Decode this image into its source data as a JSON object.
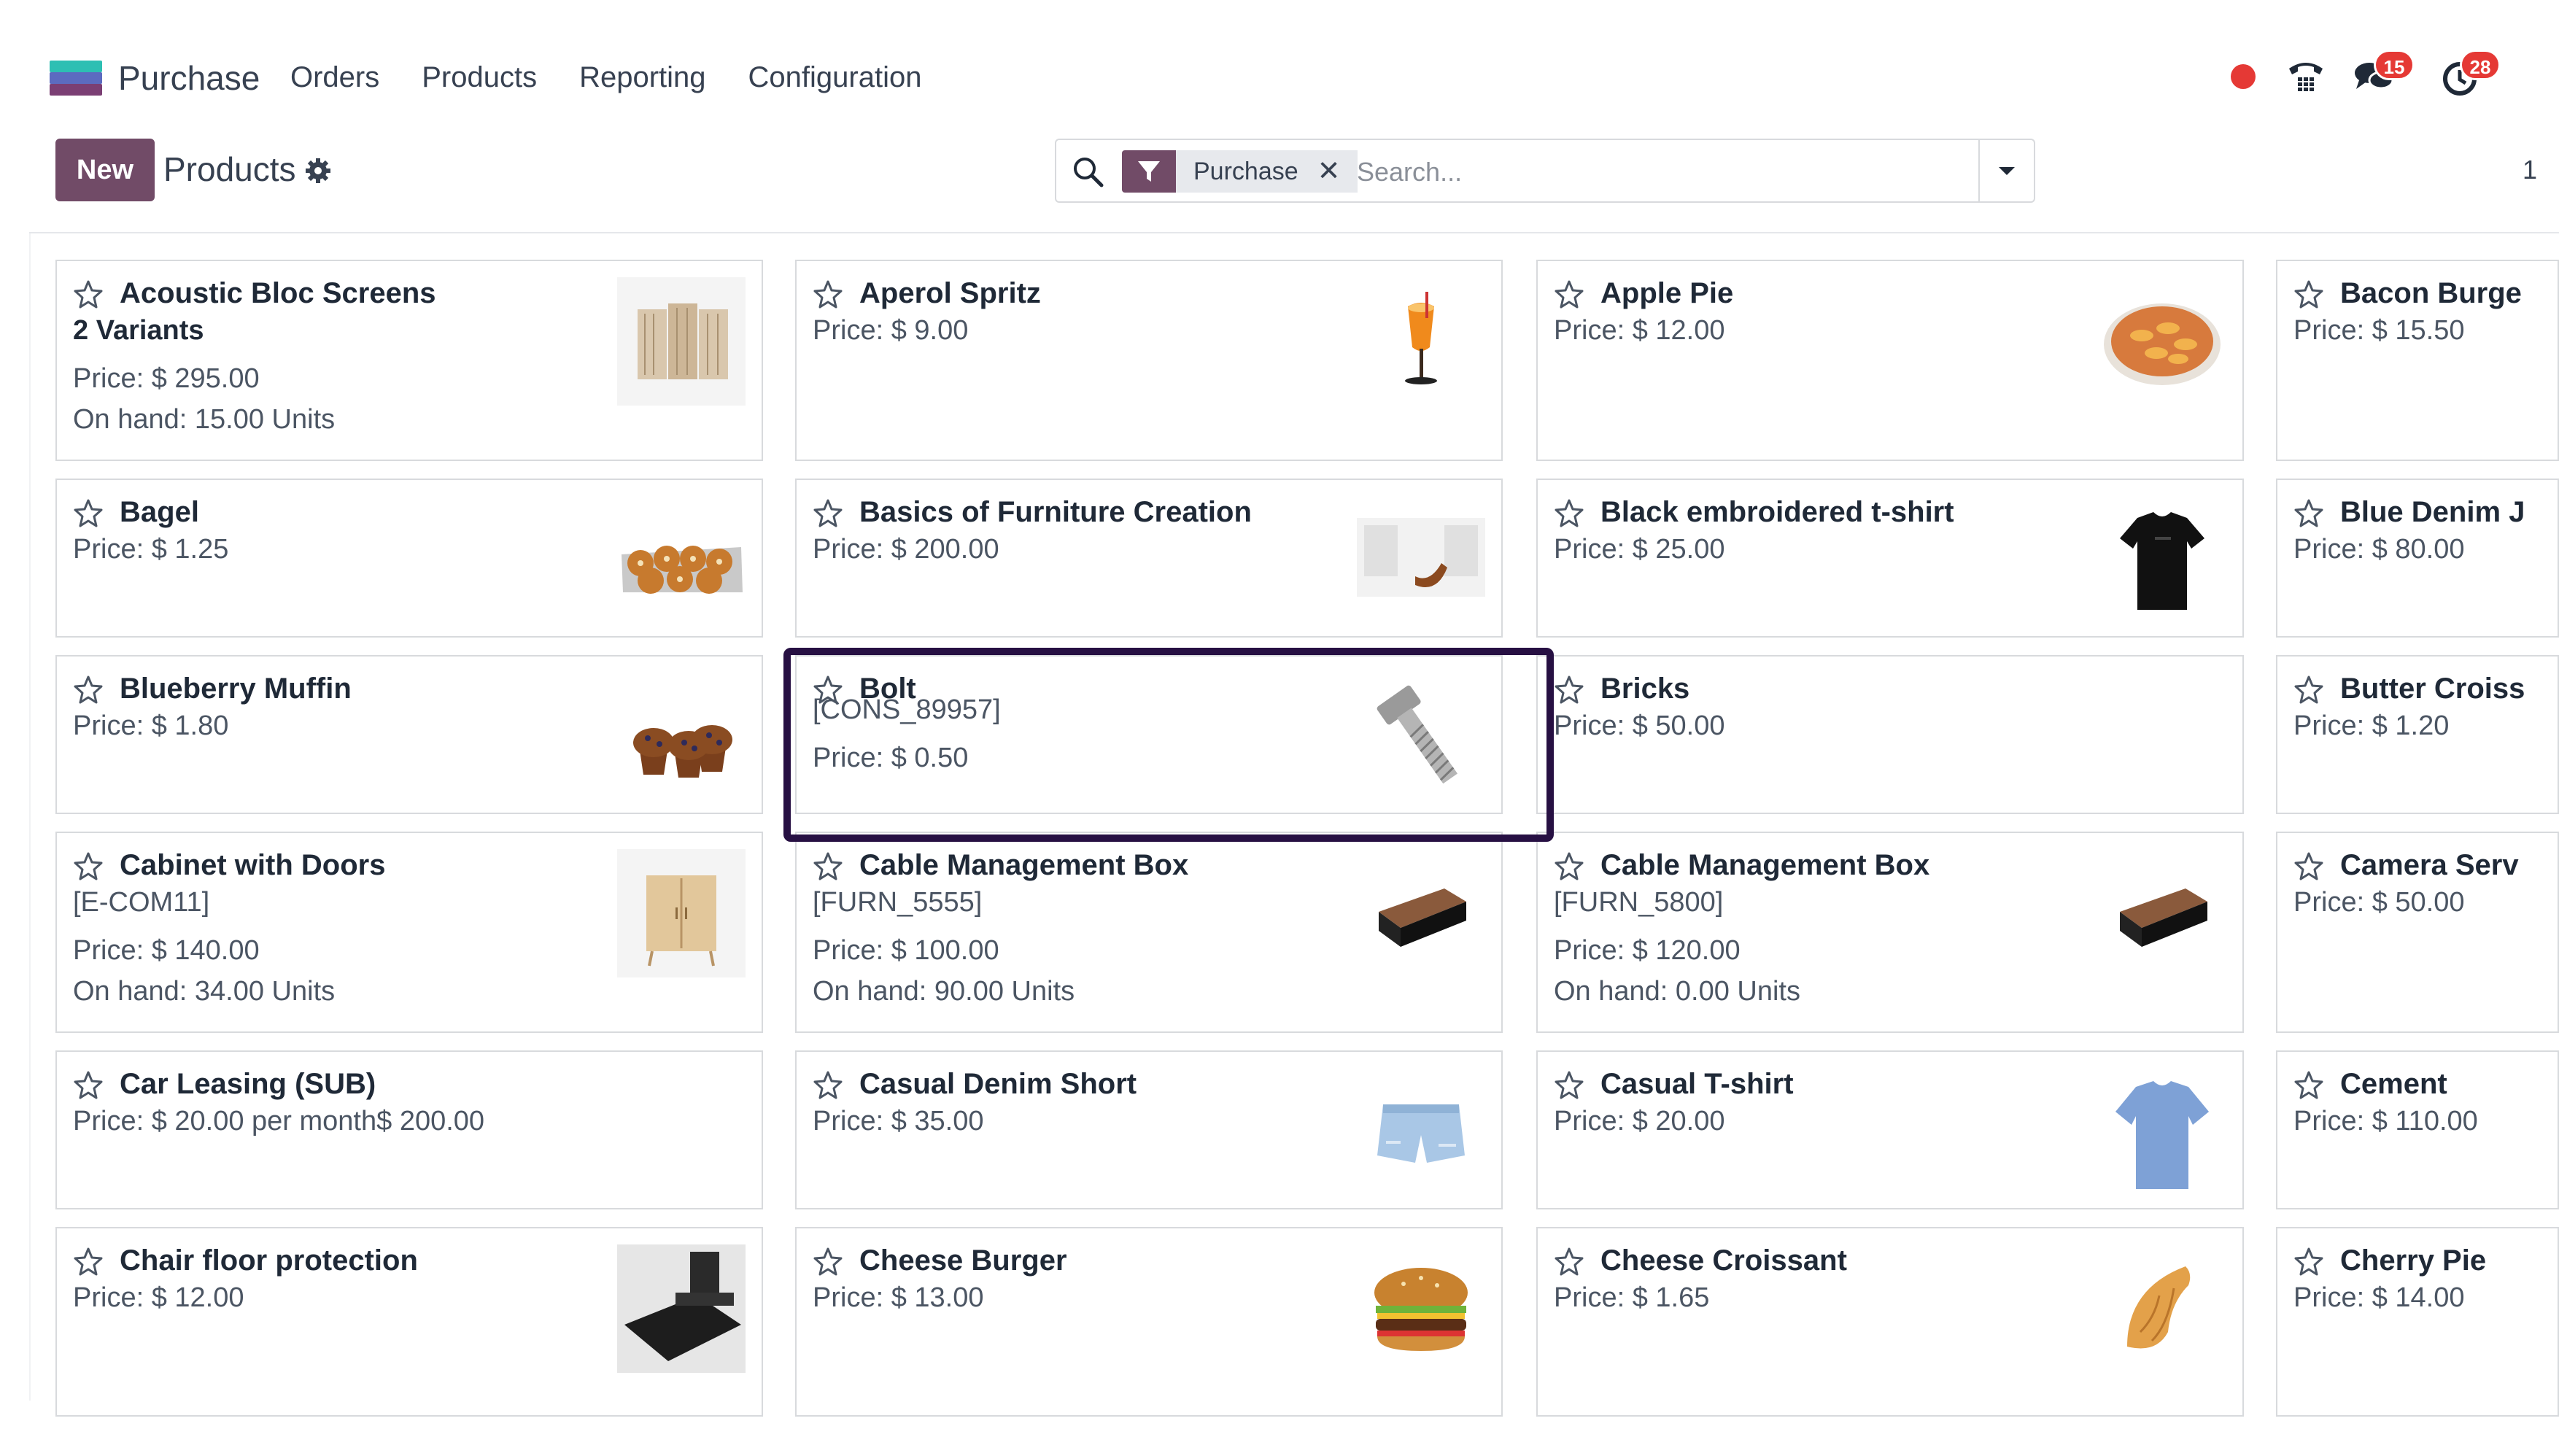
{
  "nav": {
    "app_name": "Purchase",
    "menu": [
      "Orders",
      "Products",
      "Reporting",
      "Configuration"
    ],
    "messages_badge": "15",
    "activities_badge": "28"
  },
  "control": {
    "new_label": "New",
    "title": "Products",
    "facet_label": "Purchase",
    "facet_close": "✕",
    "search_placeholder": "Search...",
    "pager_hint": "1"
  },
  "colors": {
    "brand": "#714b67",
    "selected_outline": "#271043",
    "badge": "#e53935"
  },
  "products": [
    {
      "name": "Acoustic Bloc Screens",
      "lines": [
        "2 Variants",
        "Price: $ 295.00",
        "On hand: 15.00 Units"
      ],
      "variants_bold": true,
      "image": "acoustic-screen-image"
    },
    {
      "name": "Aperol Spritz",
      "lines": [
        "Price: $ 9.00"
      ],
      "image": "cocktail-image"
    },
    {
      "name": "Apple Pie",
      "lines": [
        "Price: $ 12.00"
      ],
      "image": "pie-image"
    },
    {
      "name": "Bacon Burge",
      "lines": [
        "Price: $ 15.50"
      ],
      "image": ""
    },
    {
      "name": "Bagel",
      "lines": [
        "Price: $ 1.25"
      ],
      "image": "bagel-image"
    },
    {
      "name": "Basics of Furniture Creation",
      "lines": [
        "Price: $ 200.00"
      ],
      "image": "course-image"
    },
    {
      "name": "Black embroidered t-shirt",
      "lines": [
        "Price: $ 25.00"
      ],
      "image": "black-tshirt-image"
    },
    {
      "name": "Blue Denim J",
      "lines": [
        "Price: $ 80.00"
      ],
      "image": ""
    },
    {
      "name": "Blueberry Muffin",
      "lines": [
        "Price: $ 1.80"
      ],
      "image": "muffin-image"
    },
    {
      "name": "Bolt",
      "lines": [
        "[CONS_89957]",
        "Price: $ 0.50"
      ],
      "image": "bolt-image",
      "selected": true
    },
    {
      "name": "Bricks",
      "lines": [
        "Price: $ 50.00"
      ],
      "image": ""
    },
    {
      "name": "Butter Croiss",
      "lines": [
        "Price: $ 1.20"
      ],
      "image": ""
    },
    {
      "name": "Cabinet with Doors",
      "lines": [
        "[E-COM11]",
        "Price: $ 140.00",
        "On hand: 34.00 Units"
      ],
      "image": "cabinet-image"
    },
    {
      "name": "Cable Management Box",
      "lines": [
        "[FURN_5555]",
        "Price: $ 100.00",
        "On hand: 90.00 Units"
      ],
      "image": "cable-box-image"
    },
    {
      "name": "Cable Management Box",
      "lines": [
        "[FURN_5800]",
        "Price: $ 120.00",
        "On hand: 0.00 Units"
      ],
      "image": "cable-box-image"
    },
    {
      "name": "Camera Serv",
      "lines": [
        "Price: $ 50.00"
      ],
      "image": ""
    },
    {
      "name": "Car Leasing (SUB)",
      "lines": [
        "Price: $ 20.00 per month$ 200.00"
      ],
      "image": ""
    },
    {
      "name": "Casual Denim Short",
      "lines": [
        "Price: $ 35.00"
      ],
      "image": "denim-short-image"
    },
    {
      "name": "Casual T-shirt",
      "lines": [
        "Price: $ 20.00"
      ],
      "image": "blue-tshirt-image"
    },
    {
      "name": "Cement",
      "lines": [
        "Price: $ 110.00"
      ],
      "image": ""
    },
    {
      "name": "Chair floor protection",
      "lines": [
        "Price: $ 12.00"
      ],
      "image": "chair-mat-image"
    },
    {
      "name": "Cheese Burger",
      "lines": [
        "Price: $ 13.00"
      ],
      "image": "burger-image"
    },
    {
      "name": "Cheese Croissant",
      "lines": [
        "Price: $ 1.65"
      ],
      "image": "croissant-image"
    },
    {
      "name": "Cherry Pie",
      "lines": [
        "Price: $ 14.00"
      ],
      "image": ""
    }
  ]
}
